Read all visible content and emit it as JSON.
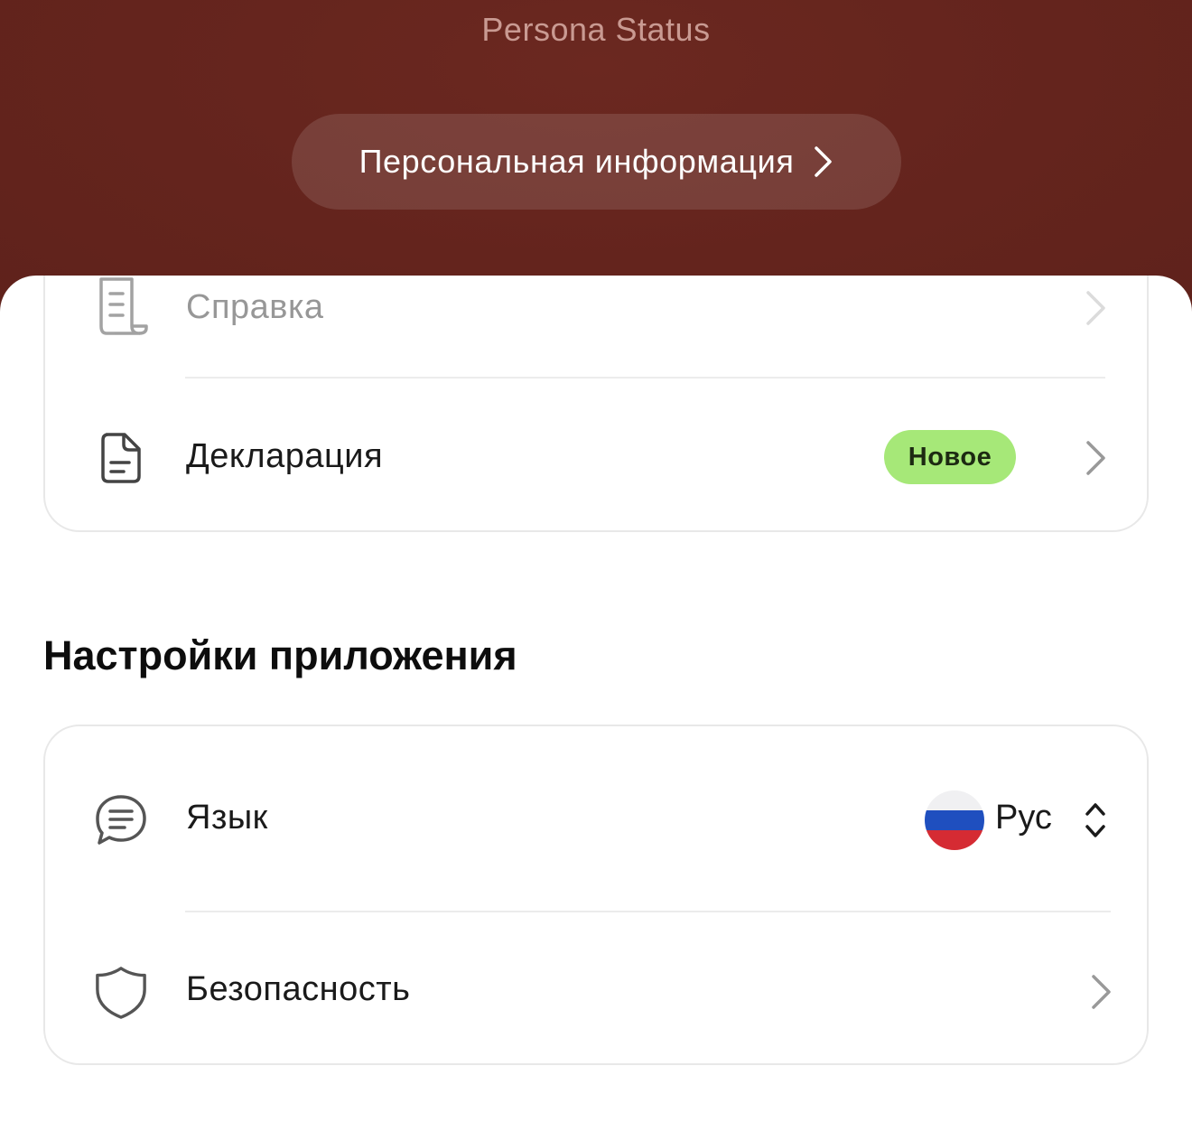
{
  "header": {
    "status_text": "Persona Status",
    "personal_info_label": "Персональная информация",
    "background_color": "#64241d"
  },
  "services": {
    "items": [
      {
        "label": "Справка",
        "icon": "scroll-icon"
      },
      {
        "label": "Декларация",
        "icon": "document-icon",
        "badge": "Новое"
      }
    ],
    "badge_color": "#a6e878"
  },
  "settings": {
    "title": "Настройки приложения",
    "language": {
      "label": "Язык",
      "value": "Рус",
      "flag": "russia-flag-icon",
      "icon": "chat-bubble-icon"
    },
    "security": {
      "label": "Безопасность",
      "icon": "shield-icon"
    }
  }
}
